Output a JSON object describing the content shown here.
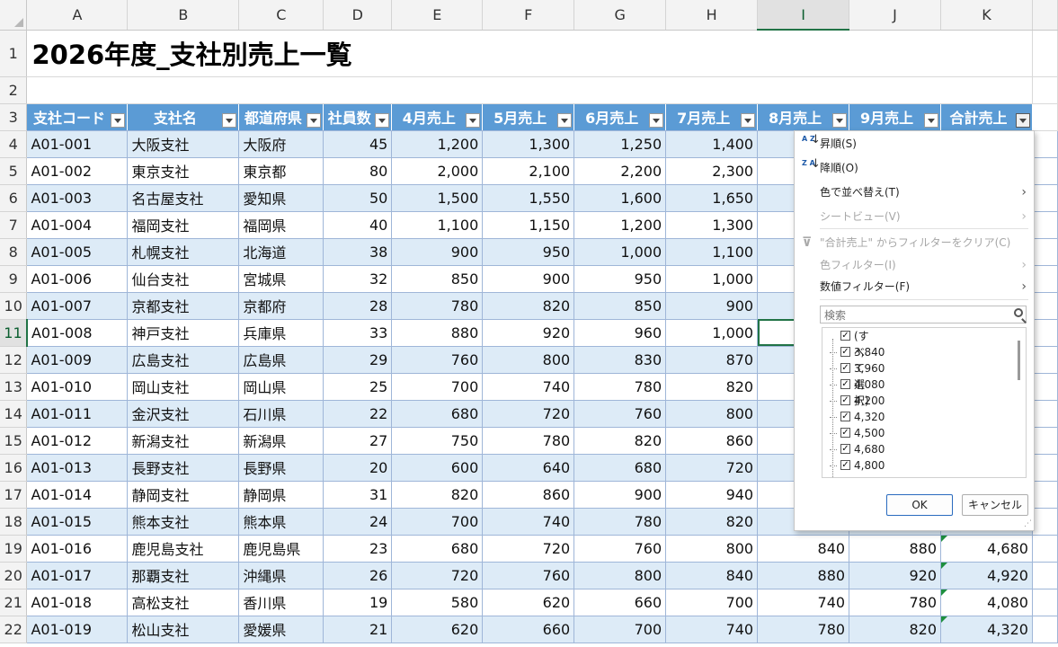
{
  "columns": [
    "A",
    "B",
    "C",
    "D",
    "E",
    "F",
    "G",
    "H",
    "I",
    "J",
    "K"
  ],
  "title": "2026年度_支社別売上一覧",
  "headers": [
    "支社コード",
    "支社名",
    "都道府県",
    "社員数",
    "4月売上",
    "5月売上",
    "6月売上",
    "7月売上",
    "8月売上",
    "9月売上",
    "合計売上"
  ],
  "rows": [
    {
      "n": "4",
      "c": [
        "A01-001",
        "大阪支社",
        "大阪府",
        "45",
        "1,200",
        "1,300",
        "1,250",
        "1,400",
        "",
        "",
        ""
      ]
    },
    {
      "n": "5",
      "c": [
        "A01-002",
        "東京支社",
        "東京都",
        "80",
        "2,000",
        "2,100",
        "2,200",
        "2,300",
        "",
        "",
        ""
      ]
    },
    {
      "n": "6",
      "c": [
        "A01-003",
        "名古屋支社",
        "愛知県",
        "50",
        "1,500",
        "1,550",
        "1,600",
        "1,650",
        "",
        "",
        ""
      ]
    },
    {
      "n": "7",
      "c": [
        "A01-004",
        "福岡支社",
        "福岡県",
        "40",
        "1,100",
        "1,150",
        "1,200",
        "1,300",
        "",
        "",
        ""
      ]
    },
    {
      "n": "8",
      "c": [
        "A01-005",
        "札幌支社",
        "北海道",
        "38",
        "900",
        "950",
        "1,000",
        "1,100",
        "",
        "",
        ""
      ]
    },
    {
      "n": "9",
      "c": [
        "A01-006",
        "仙台支社",
        "宮城県",
        "32",
        "850",
        "900",
        "950",
        "1,000",
        "",
        "",
        ""
      ]
    },
    {
      "n": "10",
      "c": [
        "A01-007",
        "京都支社",
        "京都府",
        "28",
        "780",
        "820",
        "850",
        "900",
        "",
        "",
        ""
      ]
    },
    {
      "n": "11",
      "c": [
        "A01-008",
        "神戸支社",
        "兵庫県",
        "33",
        "880",
        "920",
        "960",
        "1,000",
        "",
        "",
        ""
      ]
    },
    {
      "n": "12",
      "c": [
        "A01-009",
        "広島支社",
        "広島県",
        "29",
        "760",
        "800",
        "830",
        "870",
        "",
        "",
        ""
      ]
    },
    {
      "n": "13",
      "c": [
        "A01-010",
        "岡山支社",
        "岡山県",
        "25",
        "700",
        "740",
        "780",
        "820",
        "",
        "",
        ""
      ]
    },
    {
      "n": "14",
      "c": [
        "A01-011",
        "金沢支社",
        "石川県",
        "22",
        "680",
        "720",
        "760",
        "800",
        "",
        "",
        ""
      ]
    },
    {
      "n": "15",
      "c": [
        "A01-012",
        "新潟支社",
        "新潟県",
        "27",
        "750",
        "780",
        "820",
        "860",
        "",
        "",
        ""
      ]
    },
    {
      "n": "16",
      "c": [
        "A01-013",
        "長野支社",
        "長野県",
        "20",
        "600",
        "640",
        "680",
        "720",
        "",
        "",
        ""
      ]
    },
    {
      "n": "17",
      "c": [
        "A01-014",
        "静岡支社",
        "静岡県",
        "31",
        "820",
        "860",
        "900",
        "940",
        "",
        "",
        ""
      ]
    },
    {
      "n": "18",
      "c": [
        "A01-015",
        "熊本支社",
        "熊本県",
        "24",
        "700",
        "740",
        "780",
        "820",
        "",
        "",
        ""
      ]
    },
    {
      "n": "19",
      "c": [
        "A01-016",
        "鹿児島支社",
        "鹿児島県",
        "23",
        "680",
        "720",
        "760",
        "800",
        "840",
        "880",
        "4,680"
      ]
    },
    {
      "n": "20",
      "c": [
        "A01-017",
        "那覇支社",
        "沖縄県",
        "26",
        "720",
        "760",
        "800",
        "840",
        "880",
        "920",
        "4,920"
      ]
    },
    {
      "n": "21",
      "c": [
        "A01-018",
        "高松支社",
        "香川県",
        "19",
        "580",
        "620",
        "660",
        "700",
        "740",
        "780",
        "4,080"
      ]
    },
    {
      "n": "22",
      "c": [
        "A01-019",
        "松山支社",
        "愛媛県",
        "21",
        "620",
        "660",
        "700",
        "740",
        "780",
        "820",
        "4,320"
      ]
    }
  ],
  "filter_menu": {
    "sort_asc": "昇順(S)",
    "sort_desc": "降順(O)",
    "sort_by_color": "色で並べ替え(T)",
    "sheet_view": "シートビュー(V)",
    "clear_filter": "\"合計売上\" からフィルターをクリア(C)",
    "color_filter": "色フィルター(I)",
    "number_filter": "数値フィルター(F)",
    "search_placeholder": "検索",
    "select_all": "(すべて選択)",
    "values": [
      "3,840",
      "3,960",
      "4,080",
      "4,200",
      "4,320",
      "4,500",
      "4,680",
      "4,800"
    ],
    "ok": "OK",
    "cancel": "キャンセル",
    "az_label": "A Z",
    "za_label": "Z A"
  }
}
